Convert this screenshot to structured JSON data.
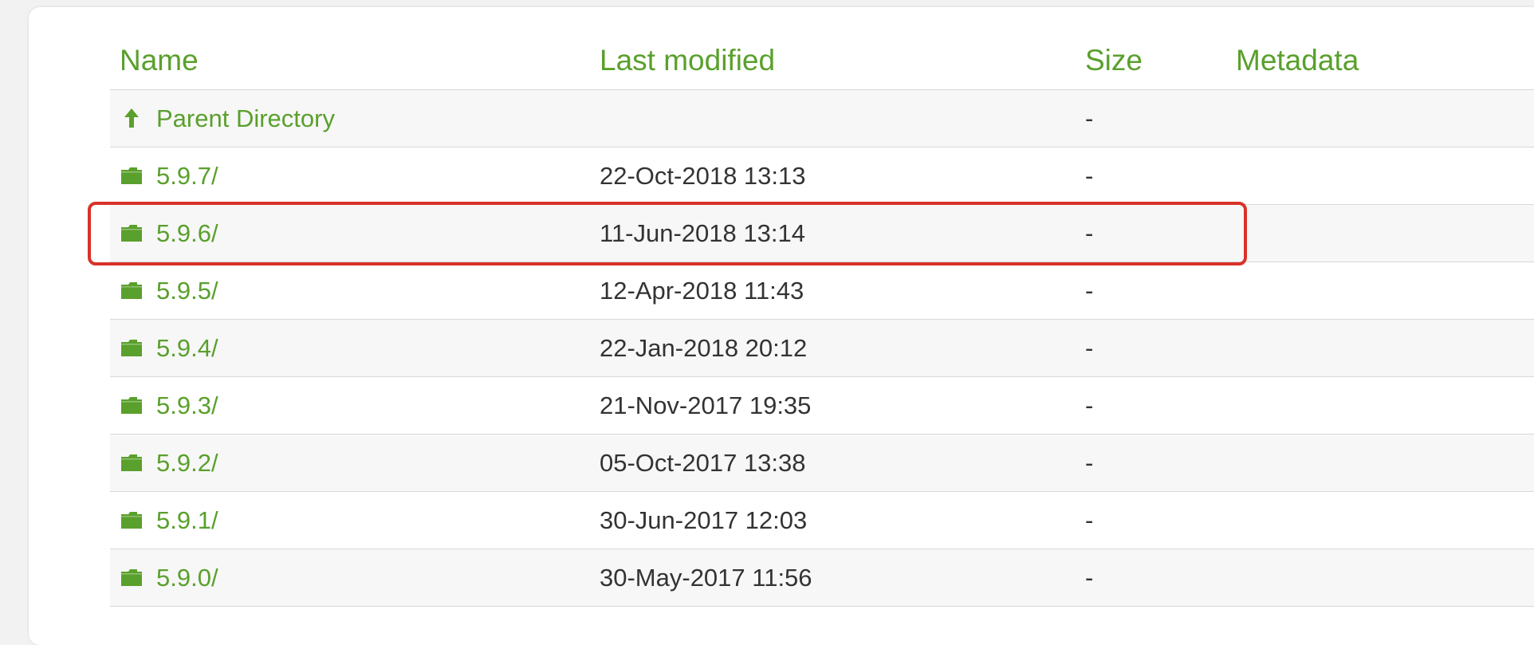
{
  "table": {
    "headers": {
      "name": "Name",
      "last_modified": "Last modified",
      "size": "Size",
      "metadata": "Metadata"
    },
    "rows": [
      {
        "name": "Parent Directory",
        "icon": "arrow-up-icon",
        "modified": "",
        "size": "-",
        "metadata": ""
      },
      {
        "name": "5.9.7/",
        "icon": "folder-icon",
        "modified": "22-Oct-2018 13:13",
        "size": "-",
        "metadata": ""
      },
      {
        "name": "5.9.6/",
        "icon": "folder-icon",
        "modified": "11-Jun-2018 13:14",
        "size": "-",
        "metadata": ""
      },
      {
        "name": "5.9.5/",
        "icon": "folder-icon",
        "modified": "12-Apr-2018 11:43",
        "size": "-",
        "metadata": ""
      },
      {
        "name": "5.9.4/",
        "icon": "folder-icon",
        "modified": "22-Jan-2018 20:12",
        "size": "-",
        "metadata": ""
      },
      {
        "name": "5.9.3/",
        "icon": "folder-icon",
        "modified": "21-Nov-2017 19:35",
        "size": "-",
        "metadata": ""
      },
      {
        "name": "5.9.2/",
        "icon": "folder-icon",
        "modified": "05-Oct-2017 13:38",
        "size": "-",
        "metadata": ""
      },
      {
        "name": "5.9.1/",
        "icon": "folder-icon",
        "modified": "30-Jun-2017 12:03",
        "size": "-",
        "metadata": ""
      },
      {
        "name": "5.9.0/",
        "icon": "folder-icon",
        "modified": "30-May-2017 11:56",
        "size": "-",
        "metadata": ""
      }
    ]
  },
  "highlight": {
    "row_name": "5.9.6/",
    "color": "#d83228"
  },
  "colors": {
    "link": "#5aa02c",
    "text": "#333333",
    "row_alt": "#f7f7f7",
    "border": "#d8d8d8"
  }
}
